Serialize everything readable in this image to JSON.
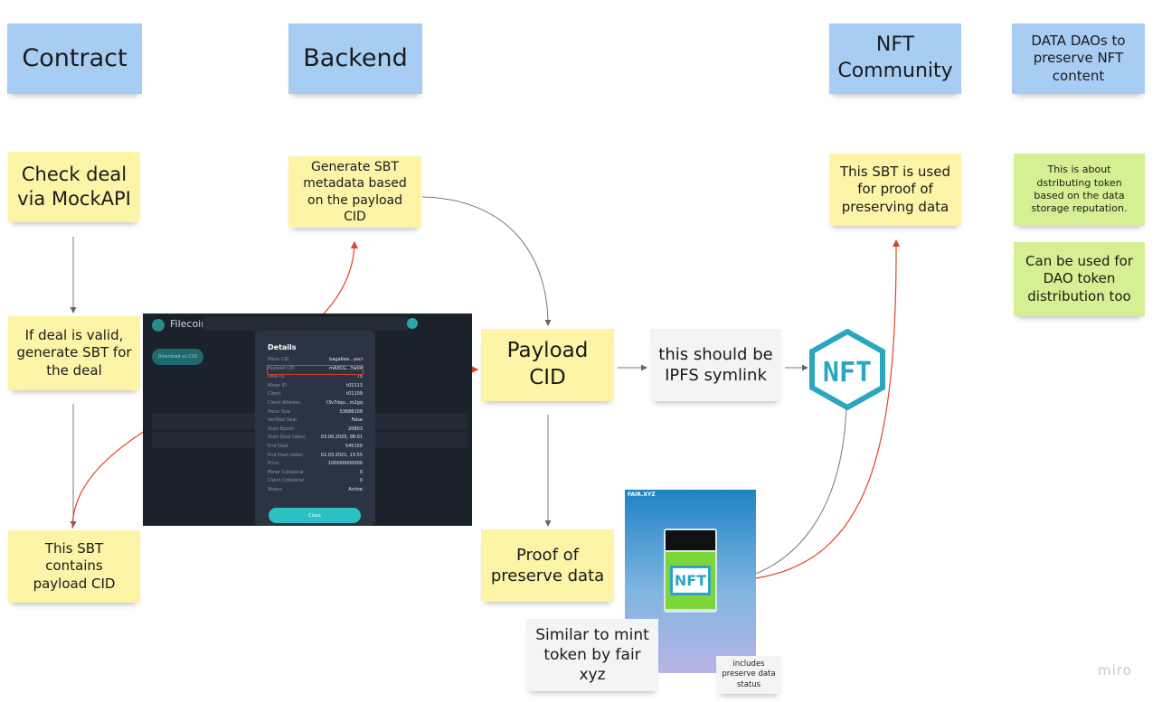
{
  "columns": {
    "contract": "Contract",
    "backend": "Backend",
    "nft_community": "NFT\nCommunity",
    "data_daos": "DATA DAOs to preserve NFT content"
  },
  "notes": {
    "check_deal": "Check deal via MockAPI",
    "deal_valid": "If deal is valid, generate SBT for the deal",
    "sbt_contains": "This SBT contains payload CID",
    "generate_sbt": "Generate SBT metadata based on the payload CID",
    "payload_cid": "Payload CID",
    "ipfs_symlink": "this should be IPFS symlink",
    "proof_preserve": "Proof of preserve data",
    "similar_mint": "Similar to mint token by fair xyz",
    "includes_status": "includes preserve data status",
    "sbt_used": "This SBT is used for proof of preserving data",
    "distributing": "This is about dstributing token based on the data storage reputation.",
    "dao_token": "Can be used for DAO token distribution too"
  },
  "filecoin_screenshot": {
    "brand": "Filecoin",
    "download": "Download as CSV",
    "details_title": "Details",
    "rows": [
      [
        "Piece CID",
        "baga6ea...uoci"
      ],
      [
        "Payload CID",
        "mAXCG...Yw04"
      ],
      [
        "Deal ID",
        "75"
      ],
      [
        "Miner ID",
        "t01113"
      ],
      [
        "Client",
        "t01109"
      ],
      [
        "Client Address",
        "t3v7dqu...m2gq"
      ],
      [
        "Piece Size",
        "53686108"
      ],
      [
        "Verified Deal",
        "False"
      ],
      [
        "Start Epoch",
        "20803"
      ],
      [
        "Start Deal (date)",
        "03.09.2020, 08:01"
      ],
      [
        "End Deal",
        "545150"
      ],
      [
        "End Deal (date)",
        "02.03.2021, 13:55"
      ],
      [
        "Price",
        "100000000000"
      ],
      [
        "Miner Collateral",
        "0"
      ],
      [
        "Client Collateral",
        "0"
      ],
      [
        "Status",
        "Active"
      ]
    ],
    "close": "Close"
  },
  "fair_image": {
    "title": "FAIR.XYZ",
    "nft_label": "NFT"
  },
  "nft_logo": "NFT",
  "brand": "miro",
  "colors": {
    "blue": "#a8cdf3",
    "yellow": "#fdf4a7",
    "green": "#d4f093",
    "red_link": "#e0432c",
    "gray_link": "#777777",
    "nft_teal": "#2aa6c0"
  }
}
